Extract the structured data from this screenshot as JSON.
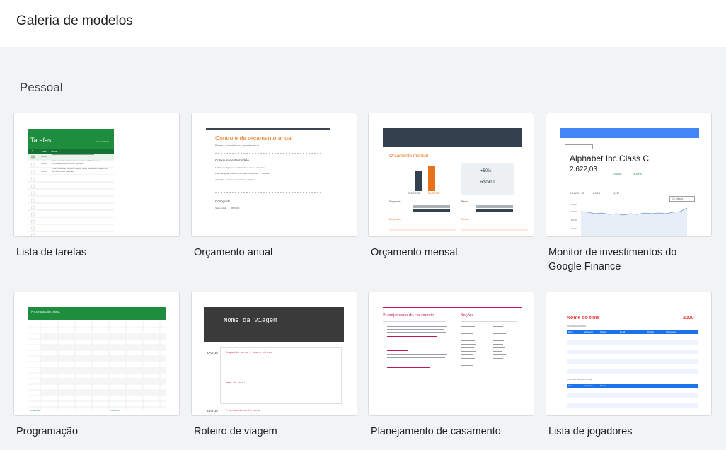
{
  "header": {
    "title": "Galeria de modelos"
  },
  "section": {
    "title": "Pessoal"
  },
  "templates": [
    {
      "label": "Lista de tarefas",
      "thumb": {
        "title": "Tarefas",
        "counter": "1/3 concluída",
        "col_done": "✓",
        "col_date": "Data",
        "col_task": "Tarefa",
        "rows": [
          {
            "date": "00/00",
            "task": "Registre aqui um evento que você quer fazer"
          },
          {
            "date": "00/00",
            "task": "Altere a saída dos itens concluídos em \"Formatar\" > \"Formatação condicional\" (à Web)"
          },
          {
            "date": "00/00",
            "task": "Para classificar os itens, use os setas seguintes ao lado do nome do título (na Web)"
          }
        ]
      }
    },
    {
      "label": "Orçamento anual",
      "thumb": {
        "title": "Controle de orçamento anual",
        "intro": "Planeje e acompanhe seu orçamento anual",
        "howto": "Como usar este modelo",
        "steps": [
          "1. Primeiro digite seu saldo inicial no item 1.2 abaixo.",
          "2. Em seguida, preencha as guias \"Despesas\" e \"Receita\".",
          "3. Por fim, confira o resultado nos gráficos."
        ],
        "config": "Configurar",
        "saldo_label": "Saldo inicial",
        "saldo_value": "R$0,000"
      }
    },
    {
      "label": "Orçamento mensal",
      "thumb": {
        "title": "Orçamento mensal",
        "pct": "+50%",
        "value": "R$500",
        "saldo_inicial": "SALDO INICIAL",
        "saldo_final": "SALDO FINAL",
        "despesas": "Despesas",
        "renda": "Renda"
      }
    },
    {
      "label": "Monitor de investimentos do Google Finance",
      "thumb": {
        "company": "Alphabet Inc Class C",
        "price": "2.622,03",
        "change_1": "+36,95",
        "change_2": "+1,43%",
        "market_cap": "1.722,27 Mi",
        "pe": "23,14",
        "beta": "1,05",
        "period": "12 Meses",
        "y_ticks": [
          "2.500,00",
          "2.000,00",
          "1.500,00",
          "1.000,00"
        ],
        "chart_accent": "#6f93c9",
        "header_color": "#4285f4"
      }
    },
    {
      "label": "Programação",
      "thumb": {
        "title": "PROGRAMAÇÃO DIÁRIA",
        "footer_left": "DIVERSÃO",
        "footer_right": "TAREFAS"
      }
    },
    {
      "label": "Roteiro de viagem",
      "thumb": {
        "title": "Nome da viagem",
        "date_1": "05/05",
        "date_2": "06/05",
        "item_1": "Companhia aérea e número do voo",
        "item_2": "Nome do hotel",
        "item_3": "Programa da conferência"
      }
    },
    {
      "label": "Planejamento de casamento",
      "thumb": {
        "title": "Planejamento do casamento",
        "sections": "Seções"
      }
    },
    {
      "label": "Lista de jogadores",
      "thumb": {
        "title": "Nome do time",
        "year": "2000",
        "subtitle": "LISTA DE JOGADORES",
        "subtitle_2": "COMISSÃO TÉCNICA DO TIME",
        "cols": [
          "Nome",
          "Sobrenome",
          "Telefone",
          "E-mail",
          "Posição",
          "Observações"
        ]
      }
    }
  ]
}
